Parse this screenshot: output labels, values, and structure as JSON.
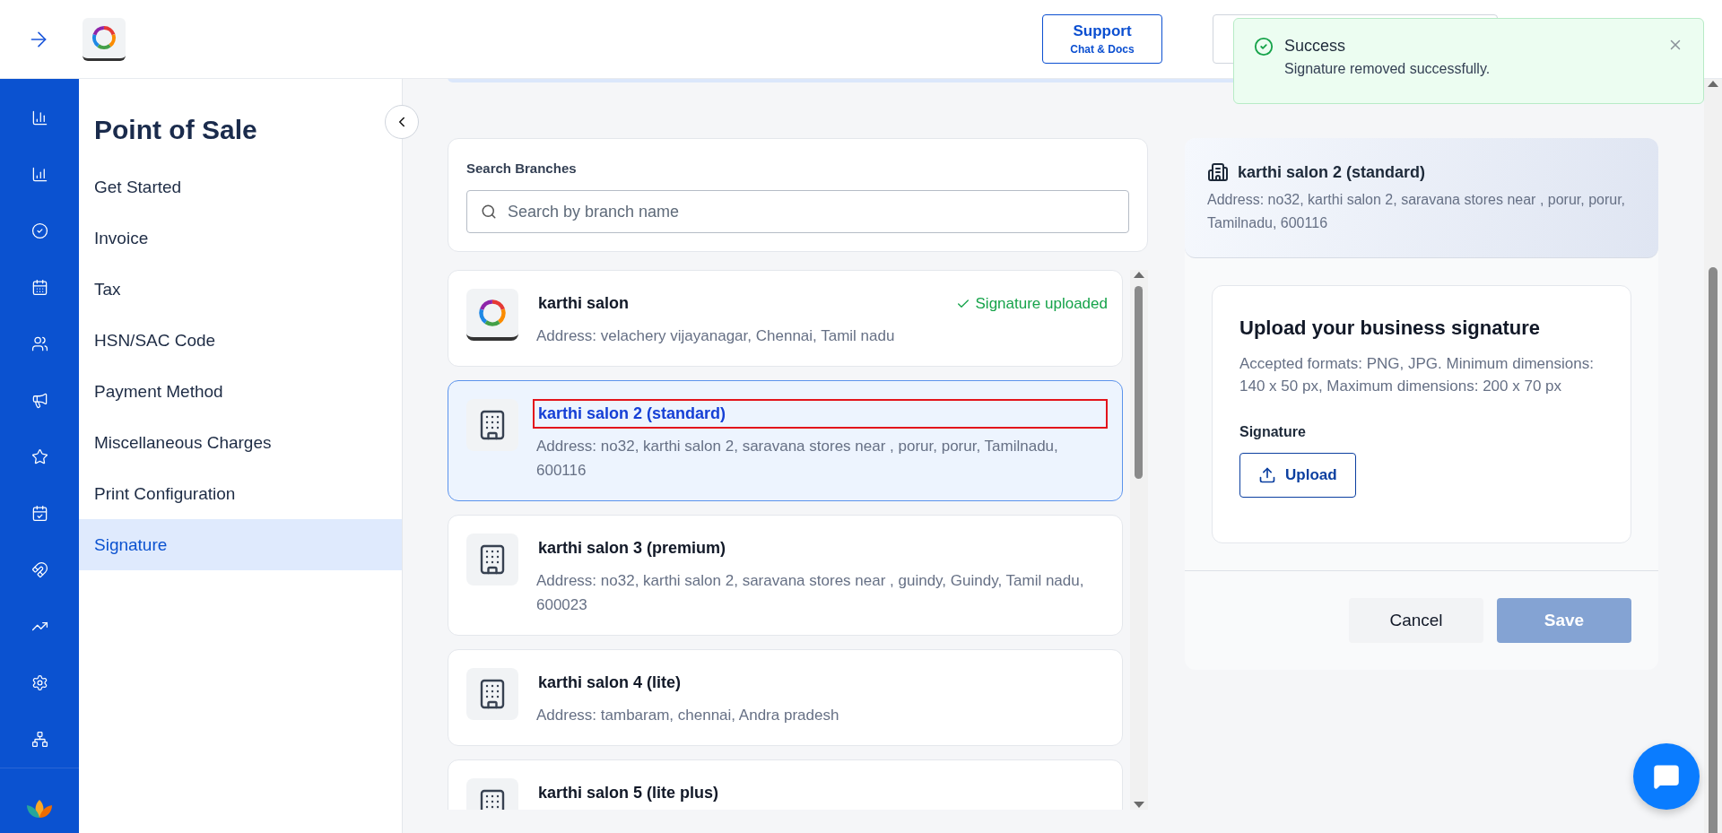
{
  "topbar": {
    "support_button": {
      "label": "Support",
      "sublabel": "Chat & Docs"
    }
  },
  "toast": {
    "title": "Success",
    "message": "Signature removed successfully."
  },
  "menu": {
    "title": "Point of Sale",
    "items": [
      {
        "label": "Get Started",
        "selected": false
      },
      {
        "label": "Invoice",
        "selected": false
      },
      {
        "label": "Tax",
        "selected": false
      },
      {
        "label": "HSN/SAC Code",
        "selected": false
      },
      {
        "label": "Payment Method",
        "selected": false
      },
      {
        "label": "Miscellaneous Charges",
        "selected": false
      },
      {
        "label": "Print Configuration",
        "selected": false
      },
      {
        "label": "Signature",
        "selected": true
      }
    ]
  },
  "search": {
    "label": "Search Branches",
    "placeholder": "Search by branch name"
  },
  "branches": [
    {
      "kind": "logo",
      "name": "karthi salon",
      "address": "Address: velachery vijayanagar, Chennai, Tamil nadu",
      "status": "Signature uploaded",
      "selected": false,
      "highlighted": false
    },
    {
      "kind": "building",
      "name": "karthi salon 2 (standard)",
      "address": "Address: no32, karthi salon 2, saravana stores near , porur, porur, Tamilnadu, 600116",
      "selected": true,
      "highlighted": true
    },
    {
      "kind": "building",
      "name": "karthi salon 3 (premium)",
      "address": "Address: no32, karthi salon 2, saravana stores near , guindy, Guindy, Tamil nadu, 600023",
      "selected": false,
      "highlighted": false
    },
    {
      "kind": "building",
      "name": "karthi salon 4 (lite)",
      "address": "Address: tambaram, chennai, Andra pradesh",
      "selected": false,
      "highlighted": false
    },
    {
      "kind": "building",
      "name": "karthi salon 5 (lite plus)",
      "selected": false,
      "highlighted": false
    }
  ],
  "detail": {
    "name": "karthi salon 2 (standard)",
    "address": "Address: no32, karthi salon 2, saravana stores near , porur, porur, Tamilnadu, 600116"
  },
  "upload": {
    "title": "Upload your business signature",
    "description": "Accepted formats: PNG, JPG. Minimum dimensions: 140 x 50 px, Maximum dimensions: 200 x 70 px",
    "field_label": "Signature",
    "button": "Upload"
  },
  "actions": [
    {
      "kind": "secondary",
      "label": "Cancel",
      "disabled": false
    },
    {
      "kind": "primary",
      "label": "Save",
      "disabled": true
    }
  ]
}
